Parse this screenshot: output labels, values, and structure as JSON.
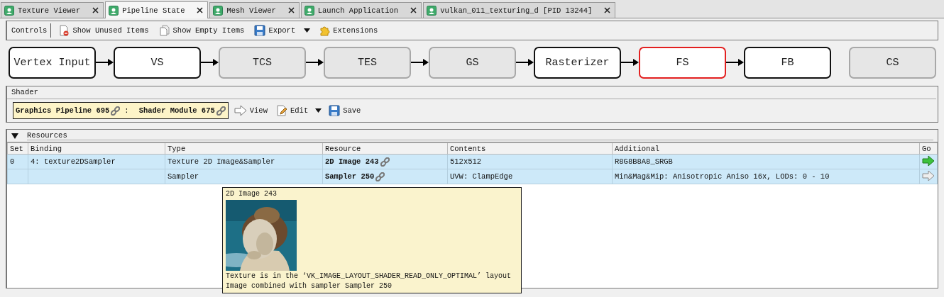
{
  "tabs": [
    {
      "label": "Texture Viewer",
      "selected": false
    },
    {
      "label": "Pipeline State",
      "selected": true
    },
    {
      "label": "Mesh Viewer",
      "selected": false
    },
    {
      "label": "Launch Application",
      "selected": false
    },
    {
      "label": "vulkan_011_texturing_d [PID 13244]",
      "selected": false
    }
  ],
  "toolbar": {
    "label": "Controls",
    "items": [
      {
        "kind": "button",
        "label": "Show Unused Items"
      },
      {
        "kind": "button",
        "label": "Show Empty Items"
      },
      {
        "kind": "button",
        "label": "Export"
      },
      {
        "kind": "dropdown"
      },
      {
        "kind": "button",
        "label": "Extensions"
      }
    ]
  },
  "stages": [
    {
      "label": "Vertex Input",
      "active": true,
      "selected": false,
      "arrow": true
    },
    {
      "label": "VS",
      "active": true,
      "selected": false,
      "arrow": true
    },
    {
      "label": "TCS",
      "active": false,
      "selected": false,
      "arrow": true
    },
    {
      "label": "TES",
      "active": false,
      "selected": false,
      "arrow": true
    },
    {
      "label": "GS",
      "active": false,
      "selected": false,
      "arrow": true
    },
    {
      "label": "Rasterizer",
      "active": true,
      "selected": false,
      "arrow": true
    },
    {
      "label": "FS",
      "active": true,
      "selected": true,
      "arrow": true
    },
    {
      "label": "FB",
      "active": true,
      "selected": false,
      "arrow": false
    },
    {
      "label": "CS",
      "active": false,
      "selected": false
    }
  ],
  "shader": {
    "title": "Shader",
    "pipeline": "Graphics Pipeline 695",
    "separator": ":",
    "module": "Shader Module 675",
    "buttons": [
      {
        "kind": "button",
        "label": "View"
      },
      {
        "kind": "button",
        "label": "Edit"
      },
      {
        "kind": "dropdown"
      },
      {
        "kind": "button",
        "label": "Save"
      }
    ]
  },
  "resources": {
    "title": "Resources",
    "expanded": true,
    "columns": [
      "Set",
      "Binding",
      "Type",
      "Resource",
      "Contents",
      "Additional",
      "Go"
    ],
    "rows": [
      {
        "cells": [
          "0",
          "4: texture2DSampler",
          "Texture 2D Image&Sampler",
          "2D Image 243",
          "512x512",
          "R8G8B8A8_SRGB"
        ],
        "go_enabled": true
      },
      {
        "cells": [
          "",
          "",
          "Sampler",
          "Sampler 250",
          "UVW: ClampEdge",
          "Min&Mag&Mip: Anisotropic Aniso 16x, LODs: 0 - 10"
        ],
        "go_enabled": false
      }
    ]
  },
  "tooltip": {
    "title": "2D Image 243",
    "lines": [
      "Texture is in the ‘VK_IMAGE_LAYOUT_SHADER_READ_ONLY_OPTIMAL’ layout",
      "Image combined with sampler Sampler 250"
    ]
  }
}
